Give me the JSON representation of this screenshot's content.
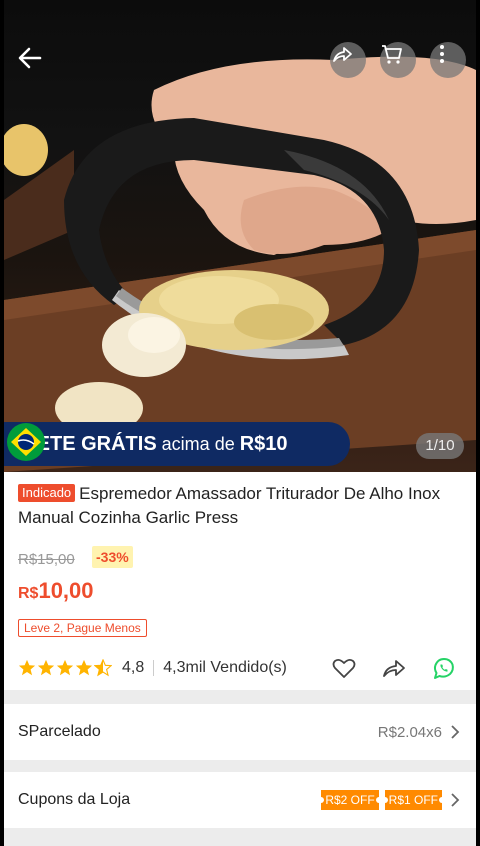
{
  "hero": {
    "banner": {
      "frete": "FRETE GRÁTIS",
      "mid": " acima de ",
      "amount": "R$10"
    },
    "counter": "1/10"
  },
  "top_icons": [
    "back-icon",
    "share-icon",
    "cart-icon",
    "more-icon"
  ],
  "product": {
    "badge": "Indicado",
    "title": "Espremedor Amassador Triturador De Alho Inox Manual Cozinha Garlic Press",
    "old_price": "R$15,00",
    "discount": "-33%",
    "price_currency": "R$",
    "price_value": "10,00",
    "promo": "Leve 2, Pague Menos",
    "rating": "4,8",
    "rating_stars": 4.5,
    "sold": "4,3mil Vendido(s)"
  },
  "rows": {
    "parcelado": {
      "label": "SParcelado",
      "value": "R$2.04x6"
    },
    "cupons": {
      "label": "Cupons da Loja",
      "coupon1": "R$2 OFF",
      "coupon2": "R$1 OFF"
    }
  },
  "colors": {
    "accent": "#ee4d2d",
    "banner": "#0f2a63",
    "star": "#ffb400",
    "whatsapp": "#25d366",
    "coupon": "#ff8a00"
  }
}
